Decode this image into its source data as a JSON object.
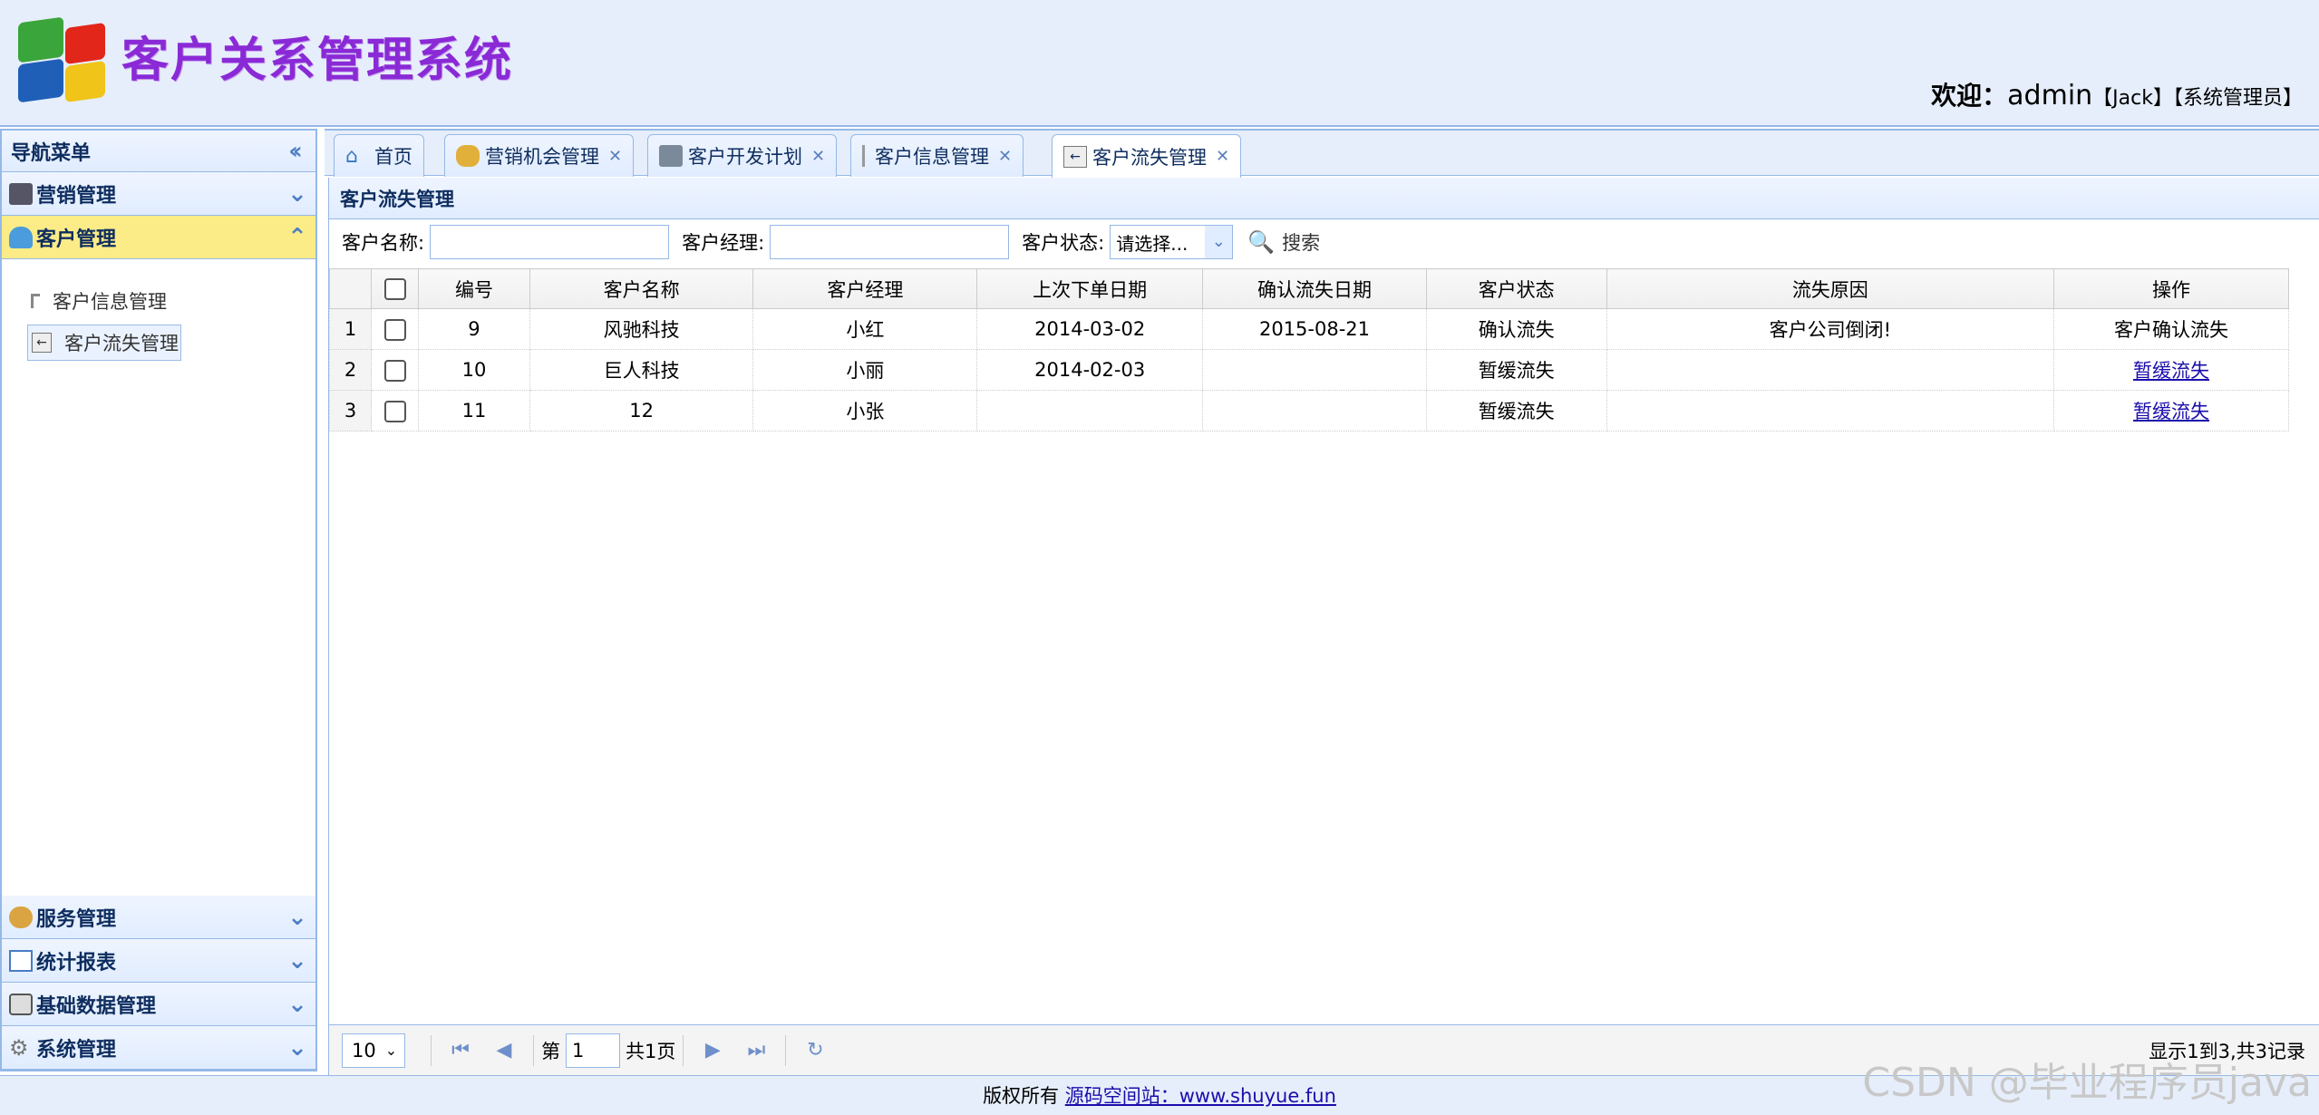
{
  "header": {
    "title": "客户关系管理系统",
    "welcome_prefix": "欢迎：",
    "username": "admin",
    "real_name": "【Jack】",
    "role": "【系统管理员】"
  },
  "sidebar": {
    "heading": "导航菜单",
    "sections": {
      "marketing": "营销管理",
      "customer": "客户管理",
      "service": "服务管理",
      "reports": "统计报表",
      "basedata": "基础数据管理",
      "system": "系统管理"
    },
    "customer_items": [
      "客户信息管理",
      "客户流失管理"
    ]
  },
  "tabs": [
    "首页",
    "营销机会管理",
    "客户开发计划",
    "客户信息管理",
    "客户流失管理"
  ],
  "panel": {
    "title": "客户流失管理",
    "search": {
      "name_label": "客户名称:",
      "manager_label": "客户经理:",
      "status_label": "客户状态:",
      "status_value": "请选择...",
      "button": "搜索"
    }
  },
  "grid": {
    "columns": [
      "编号",
      "客户名称",
      "客户经理",
      "上次下单日期",
      "确认流失日期",
      "客户状态",
      "流失原因",
      "操作"
    ],
    "rows": [
      {
        "rn": "1",
        "id": "9",
        "name": "风驰科技",
        "manager": "小红",
        "last_order": "2014-03-02",
        "confirm_date": "2015-08-21",
        "status": "确认流失",
        "reason": "客户公司倒闭!",
        "action": "客户确认流失"
      },
      {
        "rn": "2",
        "id": "10",
        "name": "巨人科技",
        "manager": "小丽",
        "last_order": "2014-02-03",
        "confirm_date": "",
        "status": "暂缓流失",
        "reason": "",
        "action": "暂缓流失"
      },
      {
        "rn": "3",
        "id": "11",
        "name": "12",
        "manager": "小张",
        "last_order": "",
        "confirm_date": "",
        "status": "暂缓流失",
        "reason": "",
        "action": "暂缓流失"
      }
    ]
  },
  "pager": {
    "page_size": "10",
    "page_prefix": "第",
    "page_value": "1",
    "page_total": "共1页",
    "info": "显示1到3,共3记录"
  },
  "footer": {
    "prefix": "版权所有",
    "link": "源码空间站：www.shuyue.fun"
  },
  "watermark": "CSDN @毕业程序员java",
  "colors": {
    "title": "#8a2ad6",
    "border": "#95b8e7",
    "active_section": "#fbec88",
    "header_bg": "#e6eefb"
  }
}
